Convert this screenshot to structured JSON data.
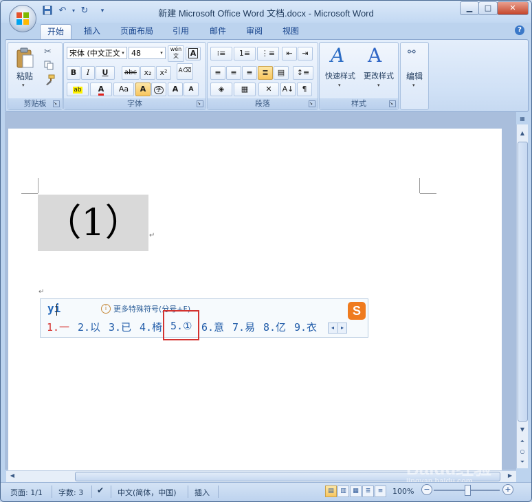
{
  "window": {
    "title": "新建 Microsoft Office Word 文档.docx - Microsoft Word",
    "controls": {
      "minimize": "▁",
      "maximize": "□",
      "close": "✕"
    }
  },
  "qat": {
    "save_icon": "save-icon",
    "undo_icon": "undo-icon",
    "redo_icon": "redo-icon",
    "customize_icon": "dropdown-icon"
  },
  "tabs": [
    {
      "label": "开始",
      "active": true
    },
    {
      "label": "插入"
    },
    {
      "label": "页面布局"
    },
    {
      "label": "引用"
    },
    {
      "label": "邮件"
    },
    {
      "label": "审阅"
    },
    {
      "label": "视图"
    }
  ],
  "help_label": "?",
  "ribbon": {
    "clipboard": {
      "label": "剪贴板",
      "paste": "粘贴"
    },
    "font": {
      "label": "字体",
      "font_name": "宋体 (中文正文",
      "font_size": "48",
      "wen": "wén\n文",
      "bold": "B",
      "italic": "I",
      "underline": "U",
      "strike": "abc",
      "subscript": "x₂",
      "superscript": "x²",
      "aa": "Aa",
      "a_shade": "A",
      "circle_char": "字",
      "grow": "A",
      "shrink": "A",
      "highlight": "ab",
      "font_color": "A"
    },
    "paragraph": {
      "label": "段落"
    },
    "styles": {
      "label": "样式",
      "quick": "快速样式",
      "change": "更改样式"
    },
    "editing": {
      "label": "编辑"
    }
  },
  "document": {
    "content": "（1）",
    "para_mark": "↵"
  },
  "ime": {
    "input": "yi",
    "hint": "更多特殊符号(分号+F)",
    "candidates": [
      "1.一",
      "2.以",
      "3.已",
      "4.椅",
      "5.①",
      "6.意",
      "7.易",
      "8.亿",
      "9.衣"
    ],
    "logo": "S",
    "nav_prev": "◂",
    "nav_next": "▸"
  },
  "status": {
    "page": "页面: 1/1",
    "words": "字数: 3",
    "language": "中文(简体，中国)",
    "insert": "插入",
    "zoom": "100%",
    "zoom_minus": "−",
    "zoom_plus": "+"
  },
  "watermark": {
    "text": "Baidu经验",
    "sub": "jingyan.baidu.com"
  },
  "colors": {
    "accent": "#2b5797",
    "highlight_border": "#d3322f",
    "ime_logo": "#ef7b1f"
  }
}
